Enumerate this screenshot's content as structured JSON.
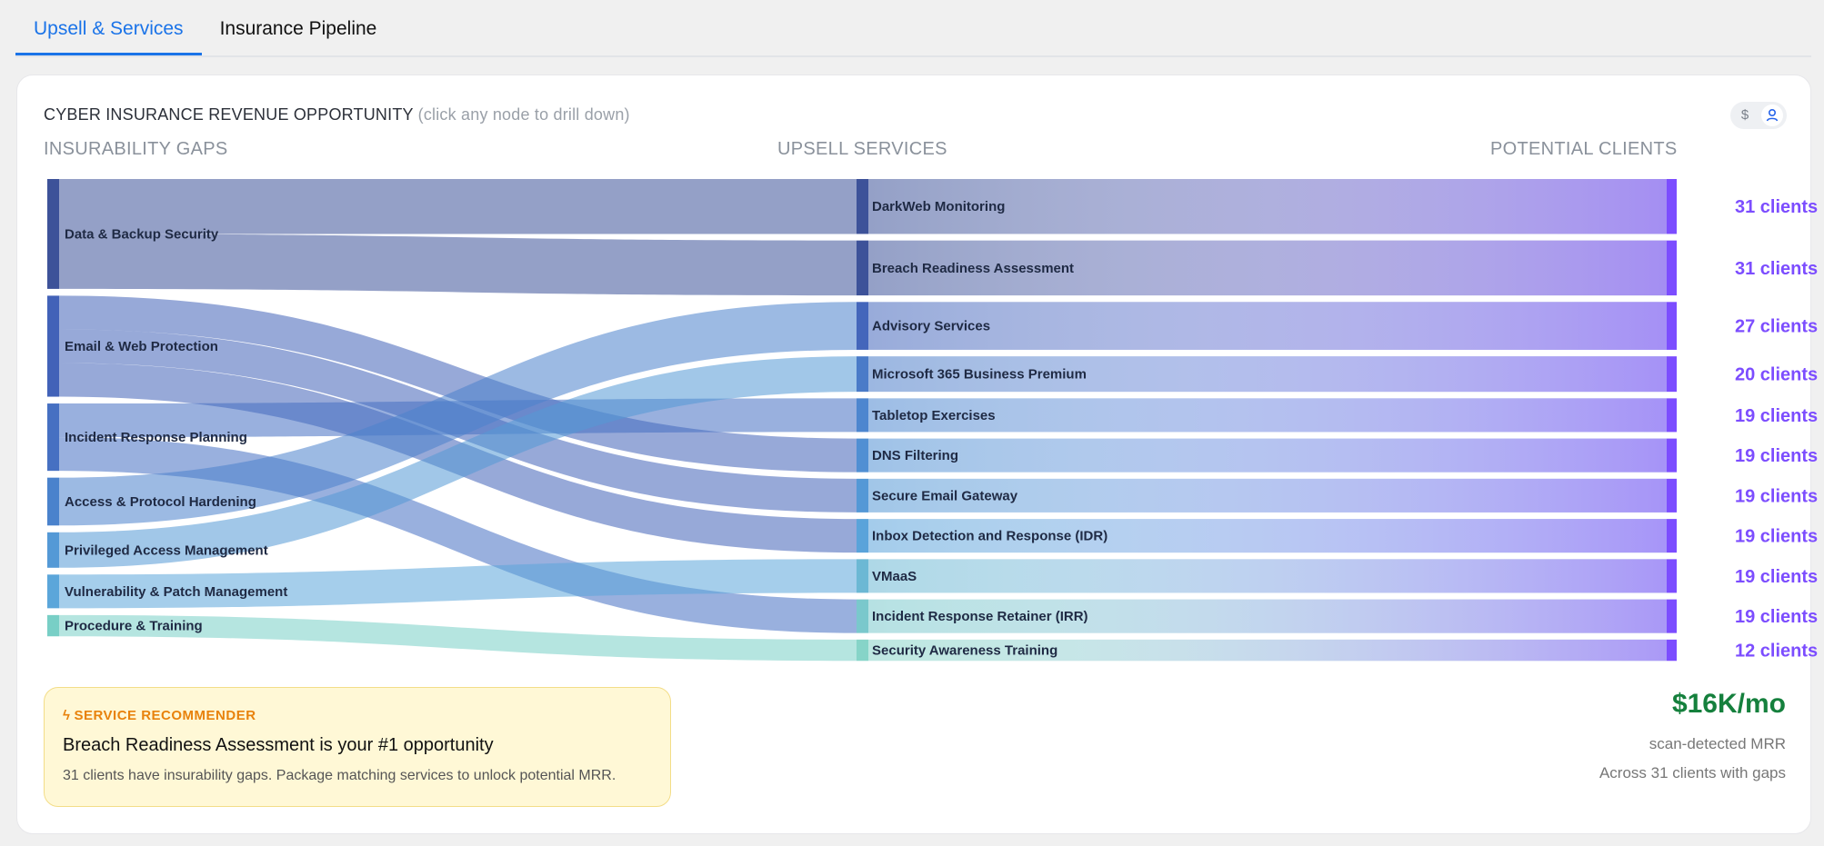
{
  "tabs": [
    {
      "label": "Upsell & Services",
      "active": true
    },
    {
      "label": "Insurance Pipeline",
      "active": false
    }
  ],
  "card": {
    "title": "CYBER INSURANCE REVENUE OPPORTUNITY",
    "hint": "(click any node to drill down)",
    "toggle": {
      "options": [
        {
          "icon": "dollar-icon",
          "glyph": "$"
        },
        {
          "icon": "user-icon",
          "glyph": "⚲"
        }
      ],
      "active": "user-icon"
    }
  },
  "columns": {
    "left": "INSURABILITY GAPS",
    "middle": "UPSELL SERVICES",
    "right": "POTENTIAL CLIENTS"
  },
  "chart_data": {
    "type": "sankey",
    "sources": [
      {
        "name": "Data & Backup Security",
        "color": "#3d5299"
      },
      {
        "name": "Email & Web Protection",
        "color": "#4262b8"
      },
      {
        "name": "Incident Response Planning",
        "color": "#4670c2"
      },
      {
        "name": "Access & Protocol Hardening",
        "color": "#4a82cc"
      },
      {
        "name": "Privileged Access Management",
        "color": "#5499d6"
      },
      {
        "name": "Vulnerability & Patch Management",
        "color": "#5ba6da"
      },
      {
        "name": "Procedure & Training",
        "color": "#78cfc6"
      }
    ],
    "targets": [
      {
        "name": "DarkWeb Monitoring",
        "clients": "31 clients",
        "color": "#3d5299"
      },
      {
        "name": "Breach Readiness Assessment",
        "clients": "31 clients",
        "color": "#3d5299"
      },
      {
        "name": "Advisory Services",
        "clients": "27 clients",
        "color": "#4466bb"
      },
      {
        "name": "Microsoft 365 Business Premium",
        "clients": "20 clients",
        "color": "#4a7bc8"
      },
      {
        "name": "Tabletop Exercises",
        "clients": "19 clients",
        "color": "#4d86cf"
      },
      {
        "name": "DNS Filtering",
        "clients": "19 clients",
        "color": "#508fd3"
      },
      {
        "name": "Secure Email Gateway",
        "clients": "19 clients",
        "color": "#5498d6"
      },
      {
        "name": "Inbox Detection and Response (IDR)",
        "clients": "19 clients",
        "color": "#5aa3da"
      },
      {
        "name": "VMaaS",
        "clients": "19 clients",
        "color": "#6cb8d4"
      },
      {
        "name": "Incident Response Retainer (IRR)",
        "clients": "19 clients",
        "color": "#7ac8cc"
      },
      {
        "name": "Security Awareness Training",
        "clients": "12 clients",
        "color": "#86d4c8"
      }
    ],
    "links": [
      {
        "source": 0,
        "target": 0,
        "value": 31
      },
      {
        "source": 0,
        "target": 1,
        "value": 31
      },
      {
        "source": 1,
        "target": 5,
        "value": 19
      },
      {
        "source": 1,
        "target": 6,
        "value": 19
      },
      {
        "source": 1,
        "target": 7,
        "value": 19
      },
      {
        "source": 2,
        "target": 4,
        "value": 19
      },
      {
        "source": 2,
        "target": 9,
        "value": 19
      },
      {
        "source": 3,
        "target": 2,
        "value": 27
      },
      {
        "source": 4,
        "target": 3,
        "value": 20
      },
      {
        "source": 5,
        "target": 8,
        "value": 19
      },
      {
        "source": 6,
        "target": 10,
        "value": 12
      }
    ],
    "sink_color": "#7c4dff"
  },
  "recommender": {
    "tag": "SERVICE RECOMMENDER",
    "tag_icon": "bolt-icon",
    "title": "Breach Readiness Assessment is your #1 opportunity",
    "description": "31 clients have insurability gaps. Package matching services to unlock potential MRR."
  },
  "summary": {
    "mrr": "$16K/mo",
    "mrr_label": "scan-detected MRR",
    "sub": "Across 31 clients with gaps"
  }
}
